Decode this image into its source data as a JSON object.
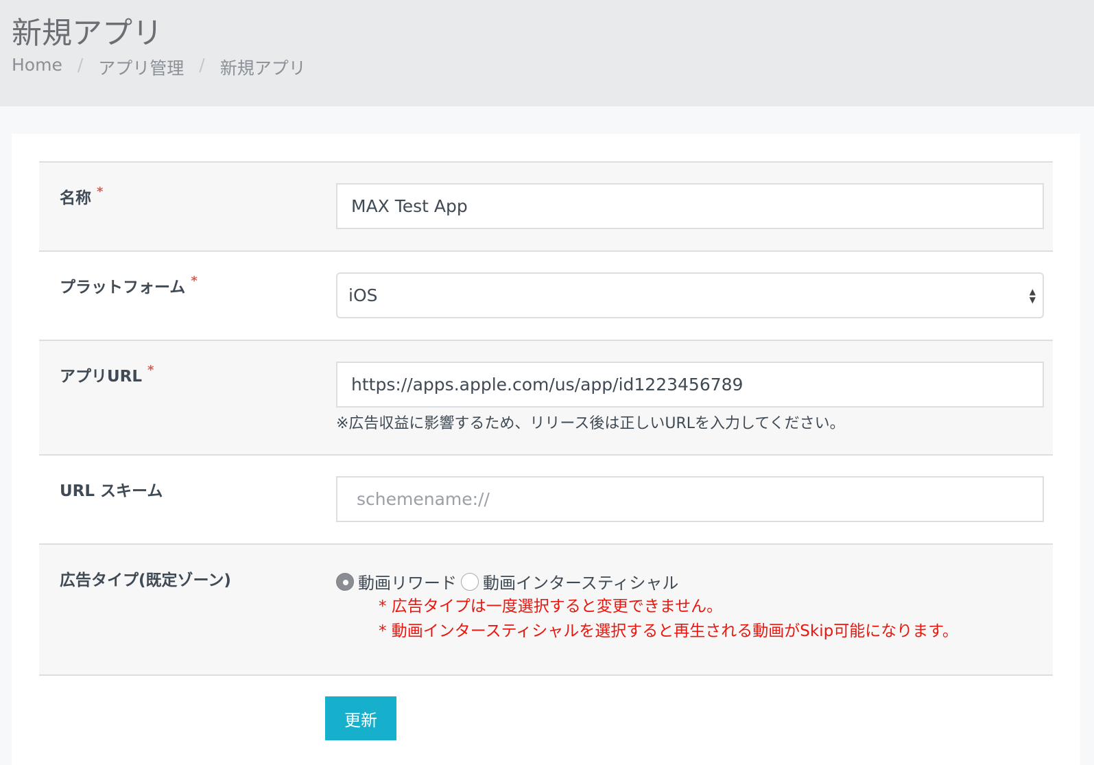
{
  "header": {
    "title": "新規アプリ",
    "breadcrumb": [
      "Home",
      "アプリ管理",
      "新規アプリ"
    ],
    "separator": "/"
  },
  "form": {
    "required_mark": "*",
    "name": {
      "label": "名称",
      "value": "MAX Test App"
    },
    "platform": {
      "label": "プラットフォーム",
      "value": "iOS"
    },
    "app_url": {
      "label": "アプリURL",
      "value": "https://apps.apple.com/us/app/id1223456789",
      "help": "※広告収益に影響するため、リリース後は正しいURLを入力してください。"
    },
    "url_scheme": {
      "label": "URL スキーム",
      "placeholder": "schemename://"
    },
    "ad_type": {
      "label": "広告タイプ(既定ゾーン)",
      "options": [
        {
          "label": "動画リワード",
          "selected": true
        },
        {
          "label": "動画インタースティシャル",
          "selected": false
        }
      ],
      "notes": [
        "* 広告タイプは一度選択すると変更できません。",
        "* 動画インタースティシャルを選択すると再生される動画がSkip可能になります。"
      ]
    },
    "submit_label": "更新"
  }
}
